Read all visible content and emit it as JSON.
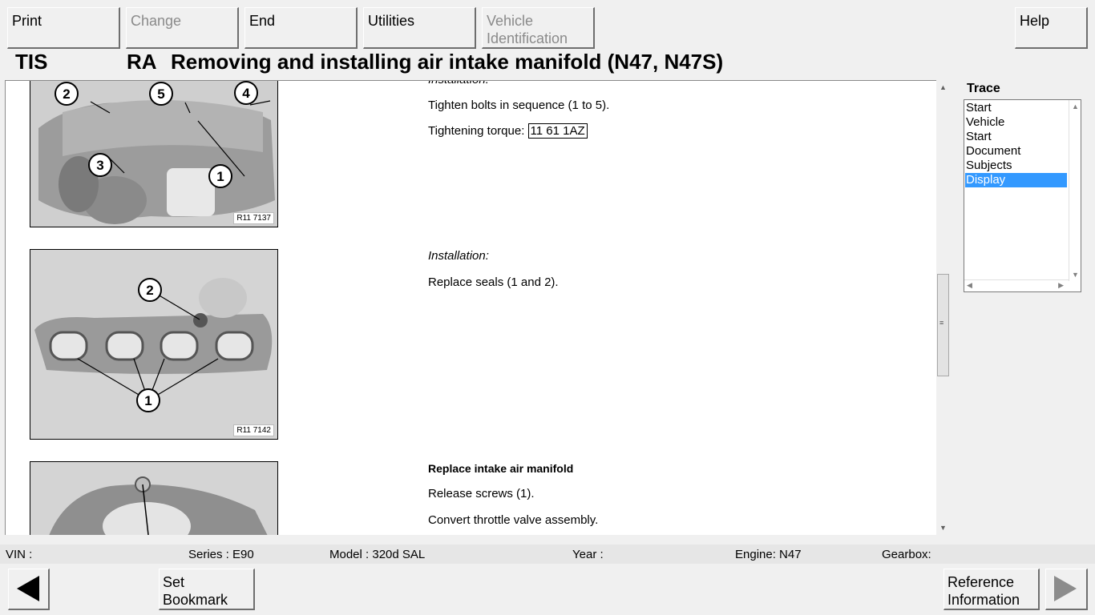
{
  "toolbar": {
    "print": "Print",
    "change": "Change",
    "end": "End",
    "utilities": "Utilities",
    "vehicle_identification": "Vehicle\nIdentification",
    "help": "Help"
  },
  "title": {
    "app": "TIS",
    "doc_type": "RA",
    "text": "Removing and installing air intake manifold (N47, N47S)"
  },
  "document": {
    "sections": [
      {
        "heading": "Installation:",
        "lines": [
          "Tighten bolts in sequence (1 to 5)."
        ],
        "torque_label": "Tightening torque:",
        "torque_ref": "11 61 1AZ",
        "figure_ref": "R11 7137",
        "callouts": [
          "1",
          "2",
          "3",
          "4",
          "5"
        ]
      },
      {
        "heading": "Installation:",
        "lines": [
          "Replace seals (1 and 2)."
        ],
        "figure_ref": "R11 7142",
        "callouts": [
          "1",
          "2"
        ]
      },
      {
        "heading": "Replace intake air manifold",
        "lines": [
          "Release screws (1).",
          "Convert throttle valve assembly."
        ]
      }
    ]
  },
  "trace": {
    "title": "Trace",
    "items": [
      "Start",
      "Vehicle",
      "Start",
      "Document",
      "Subjects",
      "Display"
    ],
    "selected_index": 5
  },
  "status": {
    "vin": "VIN :",
    "series": "Series : E90",
    "model": "Model : 320d SAL",
    "year": "Year :",
    "engine": "Engine: N47",
    "gearbox": "Gearbox:"
  },
  "bottom": {
    "set_bookmark": "Set\nBookmark",
    "reference_information": "Reference\nInformation",
    "back_icon": "triangle-left-icon",
    "forward_icon": "triangle-right-icon"
  },
  "colors": {
    "selection": "#3399ff",
    "background": "#f0f0f0",
    "content": "#ffffff"
  }
}
